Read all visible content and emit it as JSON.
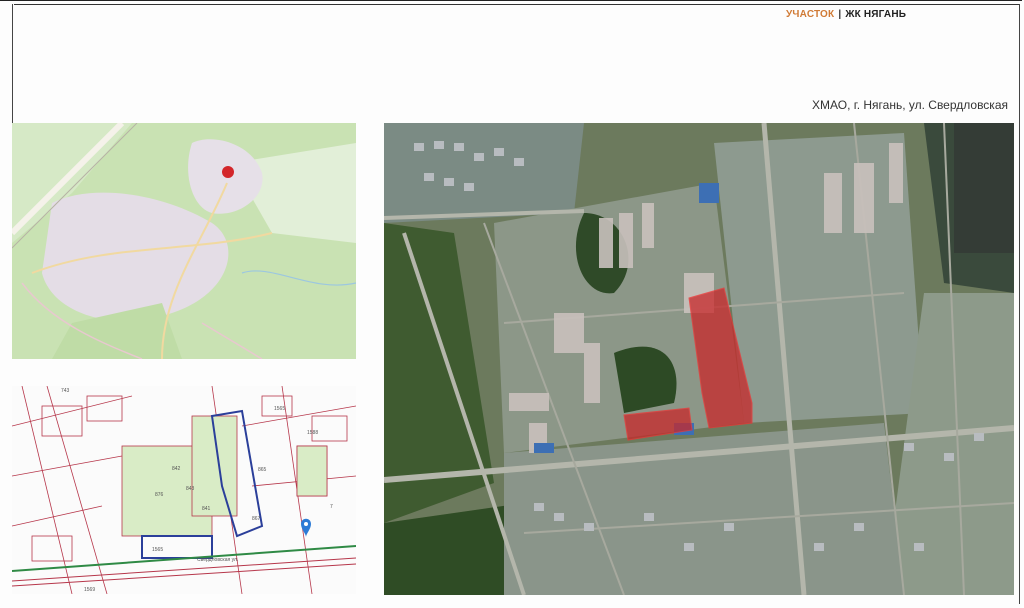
{
  "header": {
    "section": "УЧАСТОК",
    "separator": "|",
    "project": "ЖК НЯГАНЬ"
  },
  "location": {
    "address": "ХМАО, г. Нягань, ул. Свердловская"
  },
  "colors": {
    "accent": "#d07a35",
    "plot_highlight": "#c8282a",
    "marker": "#d3262a",
    "cadastral_lines": "#b6364a",
    "boundary": "#2b3f9a",
    "pin": "#2c7bd6"
  },
  "cadastral": {
    "parcel_labels": [
      "743",
      "1565",
      "876",
      "1565",
      "865",
      "1588",
      "842",
      "843",
      "841",
      "867",
      "1569",
      "7"
    ],
    "street_label": "Свердловская ул."
  }
}
